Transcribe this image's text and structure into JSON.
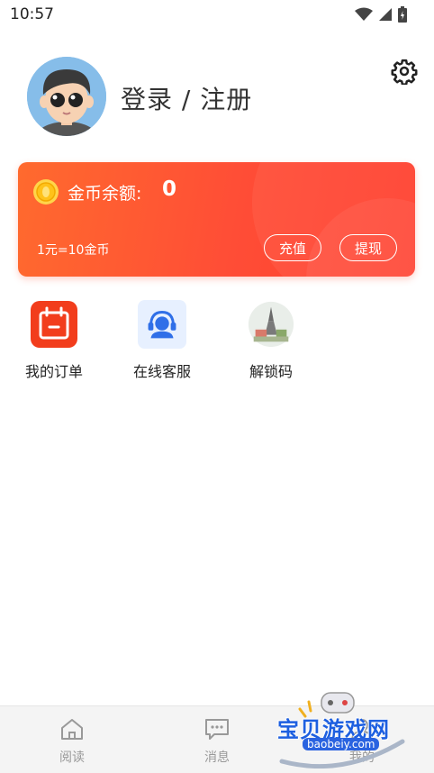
{
  "status_bar": {
    "time": "10:57"
  },
  "profile": {
    "login_label": "登录 / 注册"
  },
  "wallet": {
    "label": "金币余额:",
    "value": "0",
    "rate": "1元=10金币",
    "recharge_label": "充值",
    "withdraw_label": "提现"
  },
  "menu": [
    {
      "label": "我的订单",
      "icon": "order-calendar-icon"
    },
    {
      "label": "在线客服",
      "icon": "customer-service-icon"
    },
    {
      "label": "解锁码",
      "icon": "unlock-code-icon"
    }
  ],
  "nav": [
    {
      "label": "阅读",
      "icon": "home-icon"
    },
    {
      "label": "消息",
      "icon": "message-icon"
    },
    {
      "label": "我的",
      "icon": "profile-icon"
    }
  ],
  "watermark": {
    "title": "宝贝游戏网",
    "url": "baobeiy.com"
  },
  "colors": {
    "accent": "#ff4d36",
    "blue": "#3b7cf5"
  }
}
